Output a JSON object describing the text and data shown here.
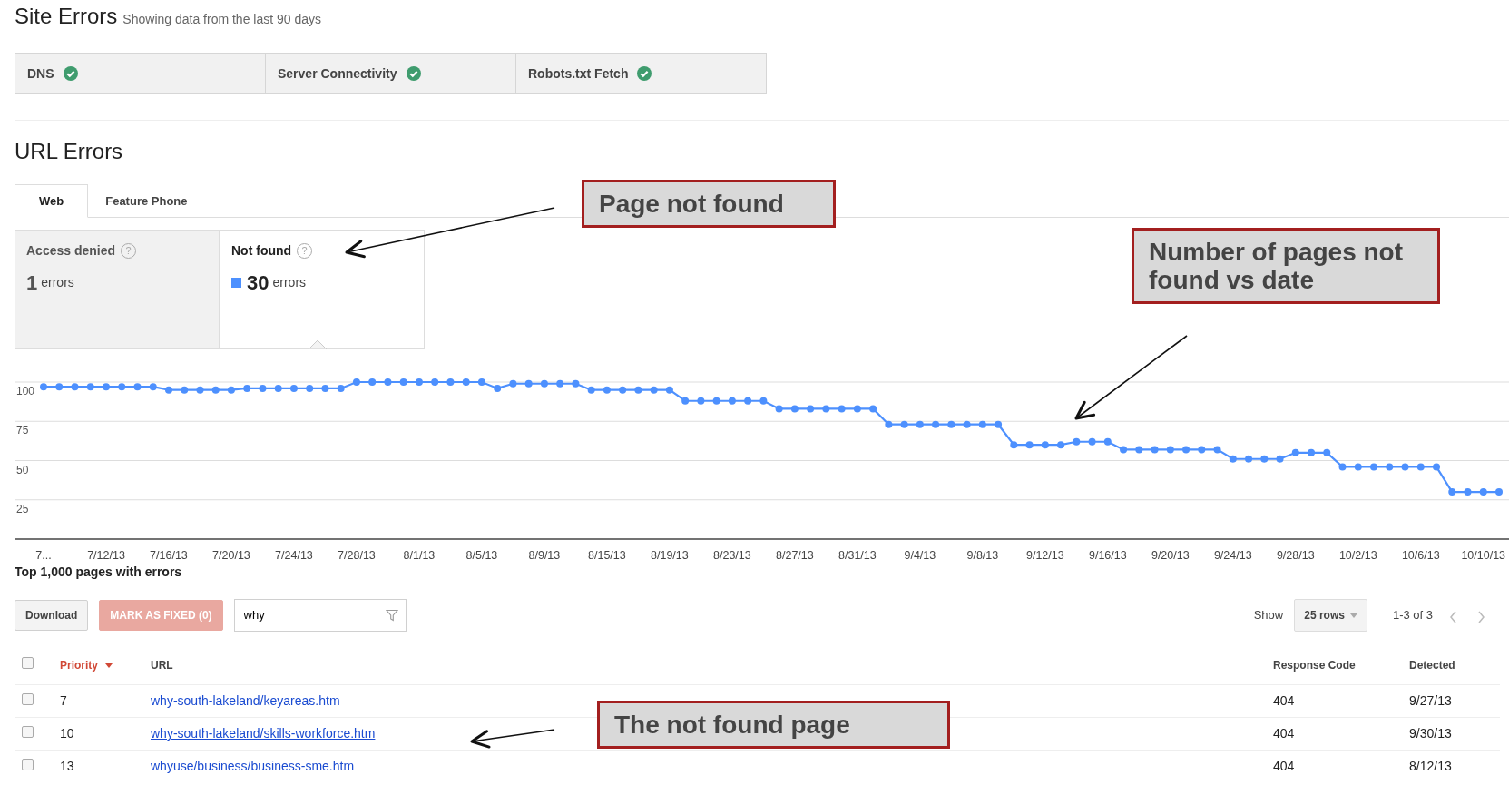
{
  "site_errors": {
    "title": "Site Errors",
    "subtitle": "Showing data from the last 90 days",
    "checks": [
      {
        "label": "DNS",
        "ok": true
      },
      {
        "label": "Server Connectivity",
        "ok": true
      },
      {
        "label": "Robots.txt Fetch",
        "ok": true
      }
    ]
  },
  "url_errors": {
    "title": "URL Errors",
    "tabs": [
      {
        "label": "Web",
        "selected": true
      },
      {
        "label": "Feature Phone",
        "selected": false
      }
    ],
    "metrics": [
      {
        "label": "Access denied",
        "help": "?",
        "count": "1",
        "unit": "errors",
        "selected": false
      },
      {
        "label": "Not found",
        "help": "?",
        "count": "30",
        "unit": "errors",
        "selected": true
      }
    ],
    "chart_data": {
      "type": "line",
      "categories": [
        "7...",
        null,
        null,
        null,
        "7/12/13",
        null,
        null,
        null,
        "7/16/13",
        null,
        null,
        null,
        "7/20/13",
        null,
        null,
        null,
        "7/24/13",
        null,
        null,
        null,
        "7/28/13",
        null,
        null,
        null,
        "8/1/13",
        null,
        null,
        null,
        "8/5/13",
        null,
        null,
        null,
        "8/9/13",
        null,
        null,
        null,
        "8/15/13",
        null,
        null,
        null,
        "8/19/13",
        null,
        null,
        null,
        "8/23/13",
        null,
        null,
        null,
        "8/27/13",
        null,
        null,
        null,
        "8/31/13",
        null,
        null,
        null,
        "9/4/13",
        null,
        null,
        null,
        "9/8/13",
        null,
        null,
        null,
        "9/12/13",
        null,
        null,
        null,
        "9/16/13",
        null,
        null,
        null,
        "9/20/13",
        null,
        null,
        null,
        "9/24/13",
        null,
        null,
        null,
        "9/28/13",
        null,
        null,
        null,
        "10/2/13",
        null,
        null,
        null,
        "10/6/13",
        null,
        null,
        null,
        "10/10/13",
        null
      ],
      "series": [
        {
          "color": "#4d90fe",
          "marker": true,
          "values": [
            97,
            97,
            97,
            97,
            97,
            97,
            97,
            97,
            95,
            95,
            95,
            95,
            95,
            96,
            96,
            96,
            96,
            96,
            96,
            96,
            100,
            100,
            100,
            100,
            100,
            100,
            100,
            100,
            100,
            96,
            99,
            99,
            99,
            99,
            99,
            95,
            95,
            95,
            95,
            95,
            95,
            88,
            88,
            88,
            88,
            88,
            88,
            83,
            83,
            83,
            83,
            83,
            83,
            83,
            73,
            73,
            73,
            73,
            73,
            73,
            73,
            73,
            60,
            60,
            60,
            60,
            62,
            62,
            62,
            57,
            57,
            57,
            57,
            57,
            57,
            57,
            51,
            51,
            51,
            51,
            55,
            55,
            55,
            46,
            46,
            46,
            46,
            46,
            46,
            46,
            30,
            30,
            30,
            30
          ]
        }
      ],
      "ylim": [
        0,
        100
      ],
      "yticks": [
        25,
        50,
        75,
        100
      ],
      "grid": true
    }
  },
  "table": {
    "title": "Top 1,000 pages with errors",
    "toolbar": {
      "download": "Download",
      "mark_fixed": {
        "label": "MARK AS FIXED (0)",
        "disabled": true
      },
      "filter": {
        "value": "why"
      },
      "show_label": "Show",
      "rows_per_page": "25 rows",
      "range": "1-3 of 3"
    },
    "select_all": {
      "checked": false
    },
    "columns": [
      {
        "label": "Priority",
        "sorted": true
      },
      {
        "label": "URL",
        "sorted": false
      },
      {
        "label": "Response Code",
        "sorted": false
      },
      {
        "label": "Detected",
        "sorted": false
      }
    ],
    "rows": [
      {
        "checked": false,
        "priority": "7",
        "url": "why-south-lakeland/keyareas.htm",
        "hovered": false,
        "response_code": "404",
        "detected": "9/27/13"
      },
      {
        "checked": false,
        "priority": "10",
        "url": "why-south-lakeland/skills-workforce.htm",
        "hovered": true,
        "response_code": "404",
        "detected": "9/30/13"
      },
      {
        "checked": false,
        "priority": "13",
        "url": "whyuse/business/business-sme.htm",
        "hovered": false,
        "response_code": "404",
        "detected": "8/12/13"
      }
    ]
  },
  "annotations": [
    {
      "text": "Page not found"
    },
    {
      "text": "Number of pages not found vs date"
    },
    {
      "text": "The not found page"
    }
  ]
}
